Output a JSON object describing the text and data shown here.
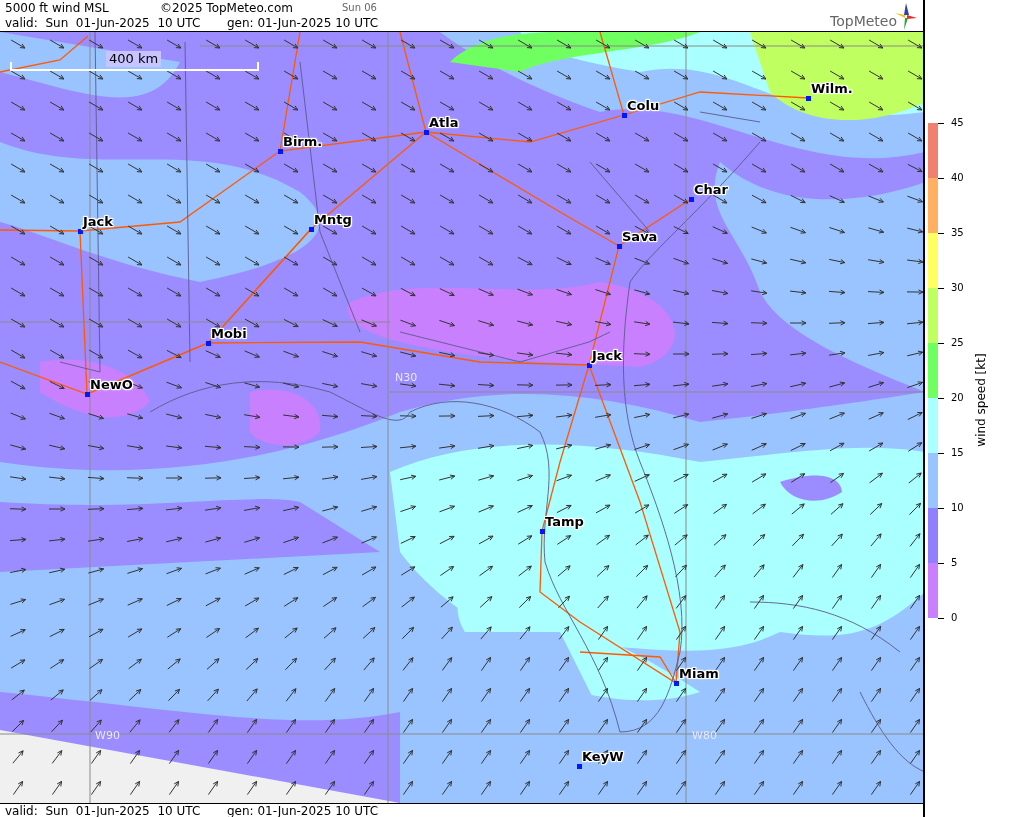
{
  "header": {
    "title": "5000 ft wind MSL",
    "copyright": "©2025 TopMeteo.com",
    "day": "Sun 06",
    "valid": "valid:  Sun  01-Jun-2025  10 UTC",
    "generated": "gen: 01-Jun-2025 10 UTC",
    "logo": "TopMeteo"
  },
  "map": {
    "scale": "400 km",
    "cities": [
      {
        "name": "Wilm."
      },
      {
        "name": "Colu"
      },
      {
        "name": "Atla"
      },
      {
        "name": "Birm."
      },
      {
        "name": "Char"
      },
      {
        "name": "Jack"
      },
      {
        "name": "Mntg"
      },
      {
        "name": "Sava"
      },
      {
        "name": "Mobi"
      },
      {
        "name": "Jack"
      },
      {
        "name": "NewO"
      },
      {
        "name": "Tamp"
      },
      {
        "name": "Miam"
      },
      {
        "name": "KeyW"
      }
    ],
    "grid_labels": [
      "N30",
      "W90",
      "W80"
    ]
  },
  "legend": {
    "title": "wind speed [kt]",
    "ticks": [
      "45",
      "40",
      "35",
      "30",
      "25",
      "20",
      "15",
      "10",
      "5",
      "0"
    ],
    "bands": [
      {
        "color": "#f08070"
      },
      {
        "color": "#ffb060"
      },
      {
        "color": "#ffff60"
      },
      {
        "color": "#c0ff60"
      },
      {
        "color": "#70ff60"
      },
      {
        "color": "#aaffff"
      },
      {
        "color": "#99c4ff"
      },
      {
        "color": "#9080ff"
      },
      {
        "color": "#c880ff"
      }
    ]
  },
  "footer": {
    "valid": "valid:  Sun  01-Jun-2025  10 UTC",
    "generated": "gen: 01-Jun-2025 10 UTC"
  }
}
